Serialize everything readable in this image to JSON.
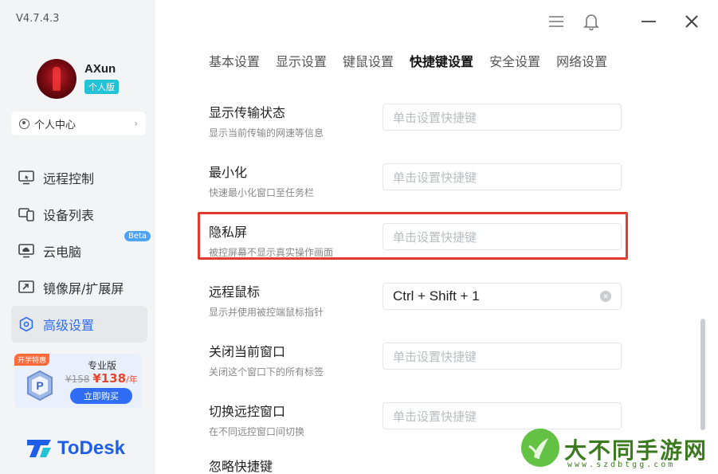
{
  "app": {
    "version": "V4.7.4.3",
    "brand_name": "ToDesk"
  },
  "user": {
    "name": "AXun",
    "plan_badge": "个人版",
    "center_label": "个人中心"
  },
  "sidebar": {
    "items": [
      {
        "label": "远程控制",
        "icon": "remote-control-icon"
      },
      {
        "label": "设备列表",
        "icon": "device-list-icon"
      },
      {
        "label": "云电脑",
        "icon": "cloud-pc-icon",
        "badge": "Beta"
      },
      {
        "label": "镜像屏/扩展屏",
        "icon": "mirror-screen-icon"
      },
      {
        "label": "高级设置",
        "icon": "advanced-settings-icon",
        "active": true
      }
    ]
  },
  "promo": {
    "tag": "开学特惠",
    "title": "专业版",
    "old_price": "¥158",
    "new_price": "¥138",
    "unit": "/年",
    "button": "立即购买"
  },
  "tabs": [
    {
      "label": "基本设置"
    },
    {
      "label": "显示设置"
    },
    {
      "label": "键鼠设置"
    },
    {
      "label": "快捷键设置",
      "active": true
    },
    {
      "label": "安全设置"
    },
    {
      "label": "网络设置"
    }
  ],
  "shortcuts": [
    {
      "title": "显示传输状态",
      "desc": "显示当前传输的网速等信息",
      "value": "",
      "placeholder": "单击设置快捷键"
    },
    {
      "title": "最小化",
      "desc": "快速最小化窗口至任务栏",
      "value": "",
      "placeholder": "单击设置快捷键"
    },
    {
      "title": "隐私屏",
      "desc": "被控屏幕不显示真实操作画面",
      "value": "",
      "placeholder": "单击设置快捷键",
      "highlighted": true
    },
    {
      "title": "远程鼠标",
      "desc": "显示并使用被控端鼠标指针",
      "value": "Ctrl + Shift + 1",
      "placeholder": ""
    },
    {
      "title": "关闭当前窗口",
      "desc": "关闭这个窗口下的所有标签",
      "value": "",
      "placeholder": "单击设置快捷键"
    },
    {
      "title": "切换远控窗口",
      "desc": "在不同远控窗口间切换",
      "value": "",
      "placeholder": "单击设置快捷键"
    },
    {
      "title": "忽略快捷键",
      "desc": "",
      "value": "",
      "placeholder": ""
    }
  ],
  "watermark": {
    "text": "大不同手游网",
    "url": "www.szdbtgg.com"
  },
  "colors": {
    "accent": "#2f6df6",
    "highlight_border": "#e23a2e",
    "badge": "#22c3d6"
  }
}
